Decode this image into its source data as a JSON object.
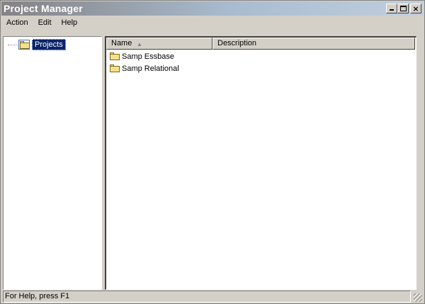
{
  "window": {
    "title": "Project Manager",
    "controls": {
      "minimize": "minimize",
      "maximize": "maximize",
      "close": "close"
    }
  },
  "menu": {
    "items": [
      {
        "label": "Action"
      },
      {
        "label": "Edit"
      },
      {
        "label": "Help"
      }
    ]
  },
  "tree": {
    "root": {
      "label": "Projects",
      "icon": "folder-icon",
      "selected": true
    }
  },
  "list": {
    "columns": [
      {
        "label": "Name",
        "sorted": "ascending"
      },
      {
        "label": "Description"
      }
    ],
    "rows": [
      {
        "name": "Samp Essbase",
        "description": "",
        "icon": "folder-icon"
      },
      {
        "name": "Samp Relational",
        "description": "",
        "icon": "folder-icon"
      }
    ]
  },
  "statusbar": {
    "text": "For Help, press F1"
  },
  "colors": {
    "selection": "#0a246a",
    "face": "#d4d0c8",
    "folder": "#f7e08a"
  }
}
